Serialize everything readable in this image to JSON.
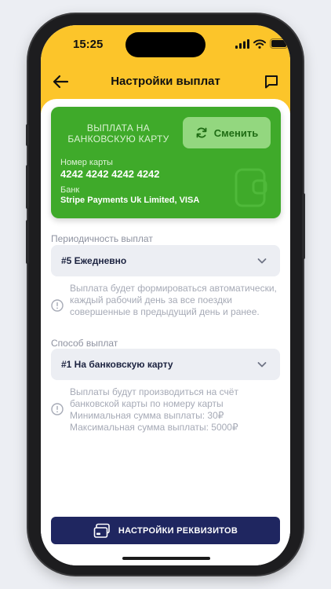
{
  "status_bar": {
    "time": "15:25"
  },
  "header": {
    "title": "Настройки выплат",
    "back_icon": "arrow-left-icon",
    "chat_icon": "chat-bubble-icon"
  },
  "card": {
    "title": "ВЫПЛАТА НА БАНКОВСКУЮ КАРТУ",
    "change_button": "Сменить",
    "number_label": "Номер карты",
    "number_value": "4242 4242 4242 4242",
    "bank_label": "Банк",
    "bank_value": "Stripe Payments Uk Limited, VISA",
    "color": "#3faa2a",
    "button_color": "#93d77f"
  },
  "frequency": {
    "label": "Периодичность выплат",
    "selected": "#5 Ежедневно",
    "info": "Выплата будет формироваться автоматически, каждый рабочий день за все поездки совершенные в предыдущий день и ранее."
  },
  "method": {
    "label": "Способ выплат",
    "selected": "#1 На банковскую карту",
    "info_lines": [
      "Выплаты будут производиться на счёт банковской карты по номеру карты",
      "Минимальная сумма выплаты: 30₽",
      "Максимальная сумма выплаты: 5000₽"
    ]
  },
  "bottom_button": {
    "label": "НАСТРОЙКИ РЕКВИЗИТОВ",
    "icon": "credit-card-icon",
    "color": "#1f2660"
  },
  "colors": {
    "accent": "#fcc52a",
    "select_bg": "#eceef3"
  }
}
